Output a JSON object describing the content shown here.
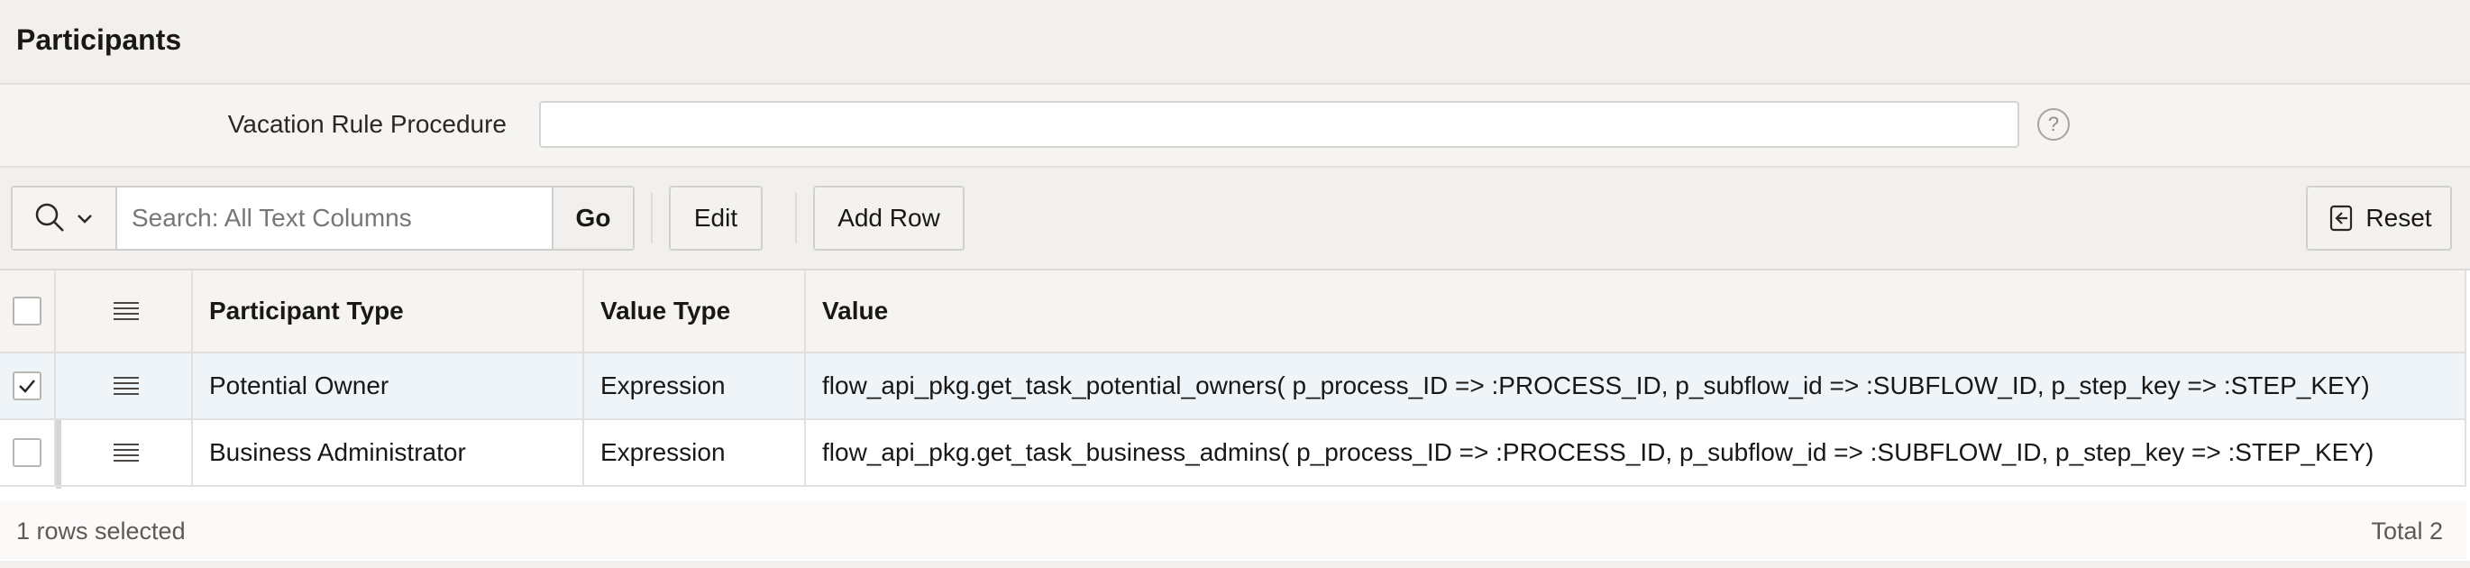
{
  "region": {
    "title": "Participants"
  },
  "form": {
    "vacation_label": "Vacation Rule Procedure",
    "vacation_value": "",
    "help_icon": "help-icon"
  },
  "toolbar": {
    "search_placeholder": "Search: All Text Columns",
    "go_label": "Go",
    "edit_label": "Edit",
    "add_row_label": "Add Row",
    "reset_label": "Reset"
  },
  "grid": {
    "columns": [
      "Participant Type",
      "Value Type",
      "Value"
    ],
    "rows": [
      {
        "selected": true,
        "participant_type": "Potential Owner",
        "value_type": "Expression",
        "value": "flow_api_pkg.get_task_potential_owners( p_process_ID => :PROCESS_ID, p_subflow_id => :SUBFLOW_ID, p_step_key => :STEP_KEY)"
      },
      {
        "selected": false,
        "participant_type": "Business Administrator",
        "value_type": "Expression",
        "value": "flow_api_pkg.get_task_business_admins( p_process_ID => :PROCESS_ID, p_subflow_id => :SUBFLOW_ID, p_step_key => :STEP_KEY)"
      }
    ],
    "selected_count_text": "1 rows selected",
    "total_text": "Total 2"
  }
}
